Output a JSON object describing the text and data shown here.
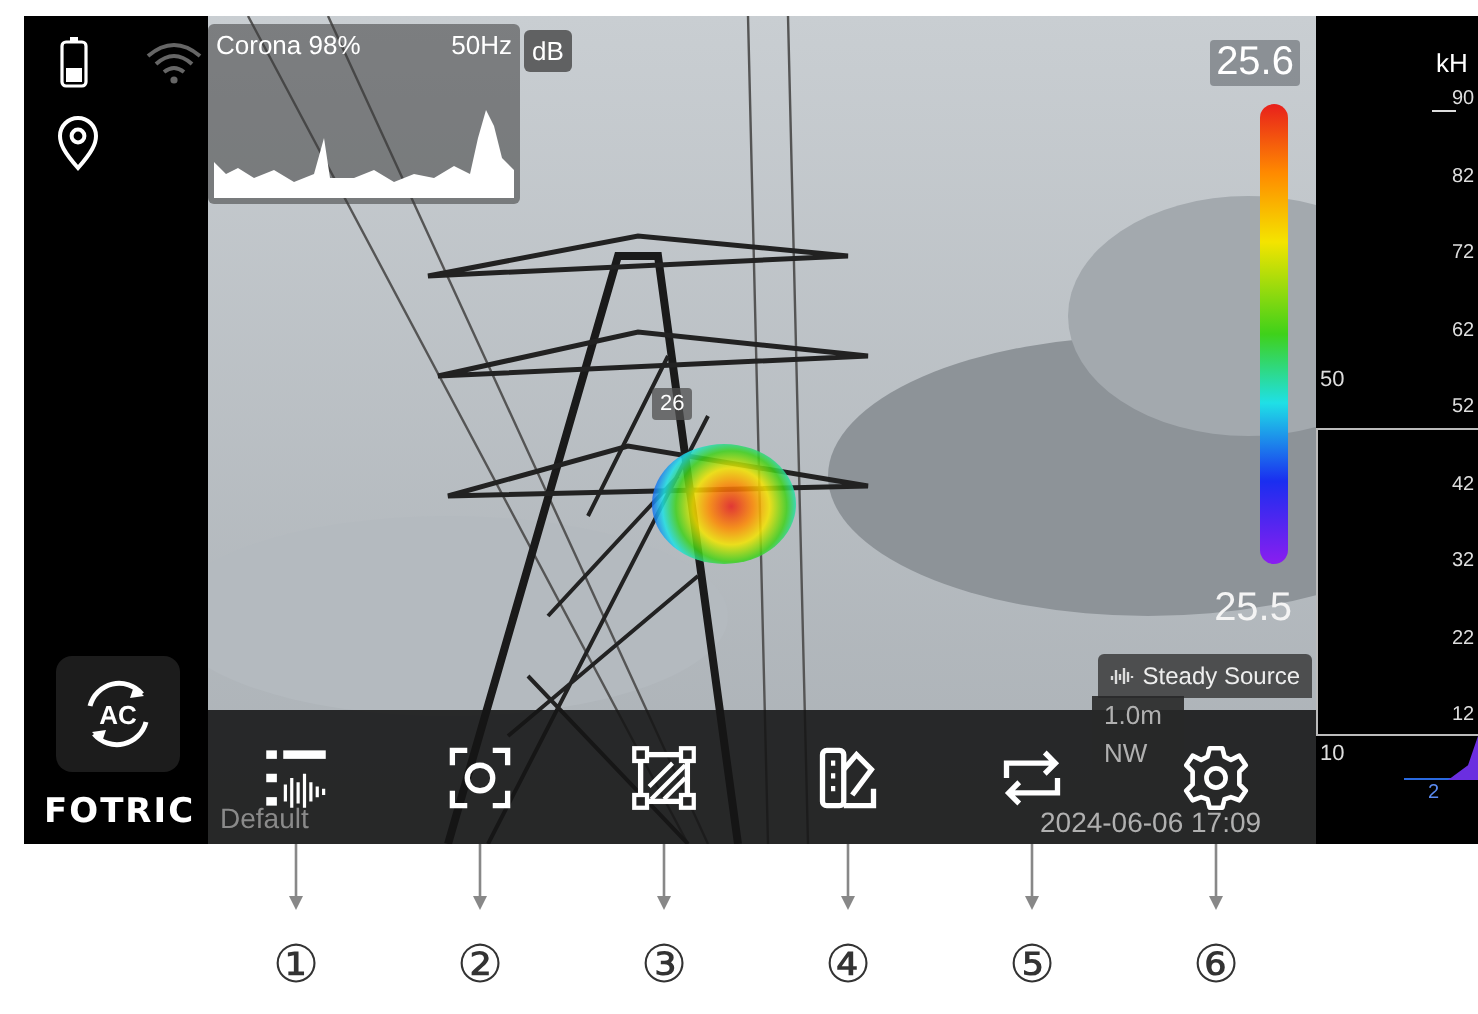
{
  "sidebar": {
    "mode_button": "AC",
    "logo": "FOTRIC"
  },
  "spectrum_inset": {
    "label": "Corona 98%",
    "frequency": "50Hz",
    "unit_button": "dB"
  },
  "color_scale": {
    "max": "25.6",
    "min": "25.5"
  },
  "hotspot": {
    "value": "26"
  },
  "source_badge": "Steady Source",
  "faded_info": {
    "preset": "Default",
    "distance": "1.0m",
    "direction": "NW",
    "timestamp": "2024-06-06 17:09"
  },
  "frequency_panel": {
    "unit": "kH",
    "ticks": [
      "90",
      "82",
      "72",
      "62",
      "52",
      "42",
      "32",
      "22",
      "12"
    ],
    "upper_label": "50",
    "lower_label": "10",
    "marker": "2"
  },
  "callouts": [
    "①",
    "②",
    "③",
    "④",
    "⑤",
    "⑥"
  ]
}
